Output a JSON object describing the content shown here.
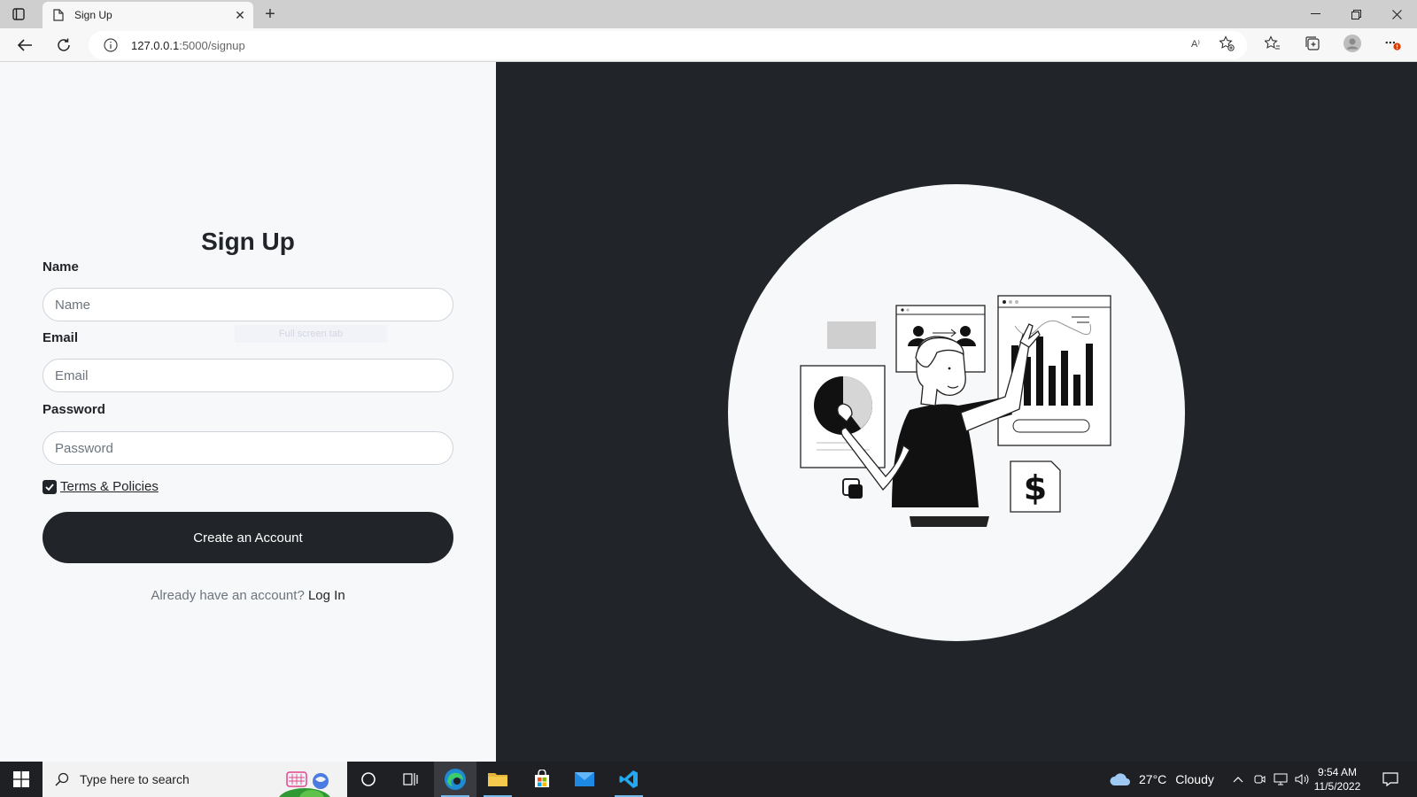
{
  "browser": {
    "tab_title": "Sign Up",
    "new_tab_symbol": "+",
    "url_host": "127.0.0.1",
    "url_path": ":5000/signup",
    "read_aloud_label": "A⁾"
  },
  "form": {
    "title": "Sign Up",
    "name_label": "Name",
    "name_placeholder": "Name",
    "email_label": "Email",
    "email_placeholder": "Email",
    "password_label": "Password",
    "password_placeholder": "Password",
    "terms_label": "Terms & Policies",
    "terms_checked": true,
    "submit_label": "Create an Account",
    "login_prompt": "Already have an account?",
    "login_link": "Log In",
    "ghost_tooltip": "Full screen tab"
  },
  "illustration": {
    "icon": "analytics-presenter-illustration",
    "dollar_symbol": "$"
  },
  "taskbar": {
    "search_placeholder": "Type here to search",
    "weather_temp": "27°C",
    "weather_condition": "Cloudy",
    "time": "9:54 AM",
    "date": "11/5/2022"
  },
  "colors": {
    "dark": "#212529",
    "panel_light": "#f7f8fa",
    "panel_dark": "#212429",
    "taskbar": "#1f2024",
    "accent": "#76b9ed"
  }
}
